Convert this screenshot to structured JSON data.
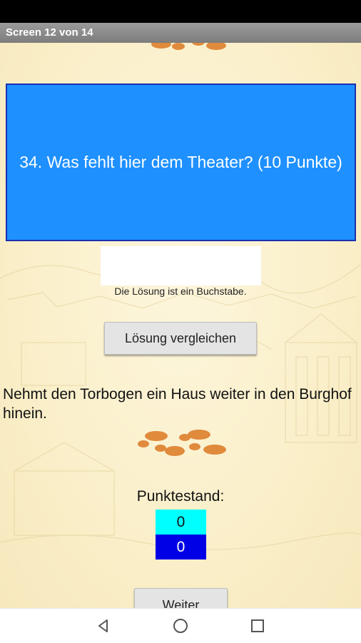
{
  "app": {
    "title": "Screen 12 von 14"
  },
  "question": {
    "text": "34. Was fehlt hier dem Theater? (10 Punkte)"
  },
  "answer": {
    "value": "",
    "placeholder": ""
  },
  "hint": "Die Lösung ist ein Buchstabe.",
  "compare_button": "Lösung vergleichen",
  "instruction": "Nehmt den Torbogen ein Haus weiter in den Burghof hinein.",
  "score": {
    "label": "Punktestand:",
    "values": [
      "0",
      "0"
    ]
  },
  "next_button": "Weiter",
  "icons": {
    "footprints": "footprints-icon",
    "back": "back-icon",
    "home": "home-icon",
    "recents": "recents-icon"
  },
  "colors": {
    "question_bg": "#1e90ff",
    "question_border": "#1c2fb0",
    "score_top_bg": "#00ffff",
    "score_bottom_bg": "#0000e6",
    "footprint": "#e08a3c",
    "background": "#fbf1cf"
  }
}
